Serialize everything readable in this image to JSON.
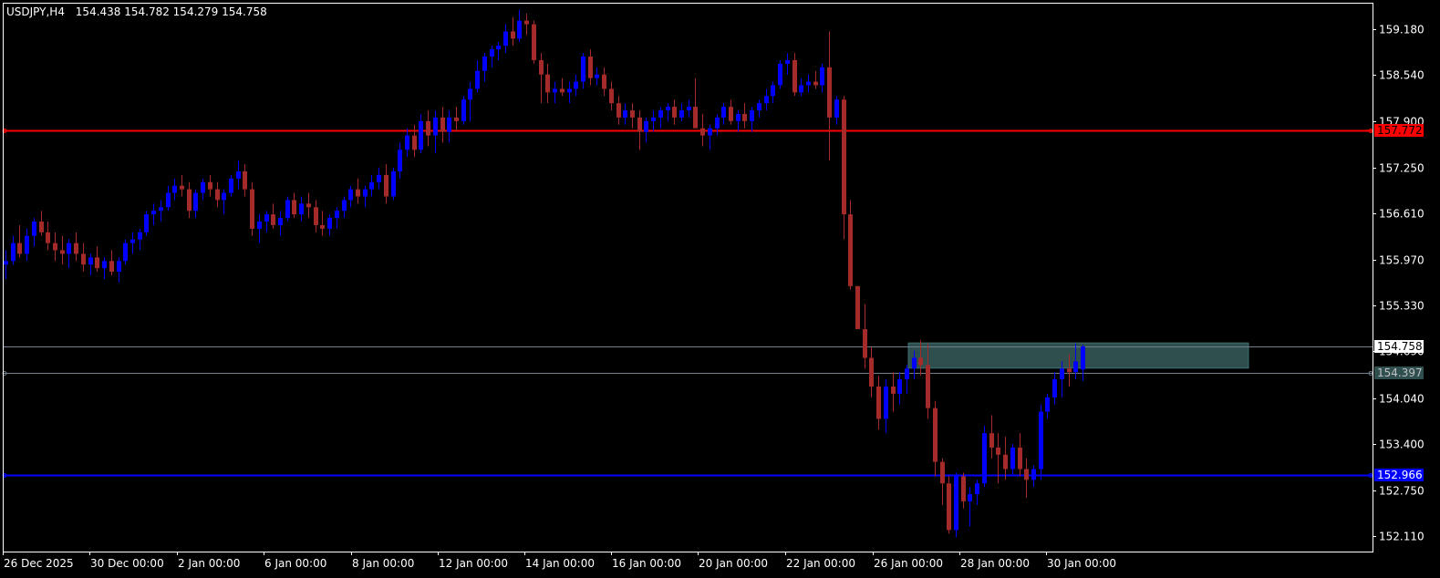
{
  "header": {
    "symbol": "USDJPY,H4",
    "ohlc": "154.438 154.782 154.279 154.758"
  },
  "colors": {
    "background": "#000000",
    "frame": "#ffffff",
    "bull": "#0000ff",
    "bear": "#a52a2a",
    "resistance": "#ff0000",
    "support": "#0000ff",
    "bid_line": "#708090",
    "zone": "#2f4f4f"
  },
  "chart_data": {
    "type": "candlestick",
    "timeframe": "H4",
    "ylim": [
      151.9,
      159.55
    ],
    "y_ticks": [
      "159.180",
      "158.540",
      "157.900",
      "157.250",
      "156.610",
      "155.970",
      "155.330",
      "154.690",
      "154.040",
      "153.400",
      "152.750",
      "152.110"
    ],
    "x_ticks": [
      "26 Dec 2025",
      "30 Dec 00:00",
      "2 Jan 00:00",
      "6 Jan 00:00",
      "8 Jan 00:00",
      "12 Jan 00:00",
      "14 Jan 00:00",
      "16 Jan 00:00",
      "20 Jan 00:00",
      "22 Jan 00:00",
      "26 Jan 00:00",
      "28 Jan 00:00",
      "30 Jan 00:00"
    ],
    "candles": [
      [
        155.9,
        156.1,
        155.7,
        155.95
      ],
      [
        155.95,
        156.3,
        155.9,
        156.2
      ],
      [
        156.2,
        156.45,
        156.0,
        156.05
      ],
      [
        156.05,
        156.4,
        155.95,
        156.3
      ],
      [
        156.3,
        156.55,
        156.15,
        156.5
      ],
      [
        156.5,
        156.65,
        156.3,
        156.35
      ],
      [
        156.35,
        156.5,
        156.1,
        156.2
      ],
      [
        156.2,
        156.35,
        155.95,
        156.1
      ],
      [
        156.1,
        156.3,
        155.9,
        156.05
      ],
      [
        156.05,
        156.25,
        155.85,
        156.2
      ],
      [
        156.2,
        156.35,
        155.95,
        156.05
      ],
      [
        156.05,
        156.2,
        155.8,
        155.9
      ],
      [
        155.9,
        156.05,
        155.75,
        156.0
      ],
      [
        156.0,
        156.15,
        155.8,
        155.85
      ],
      [
        155.85,
        156.0,
        155.7,
        155.95
      ],
      [
        155.95,
        156.1,
        155.75,
        155.8
      ],
      [
        155.8,
        156.0,
        155.65,
        155.95
      ],
      [
        155.95,
        156.25,
        155.9,
        156.2
      ],
      [
        156.2,
        156.35,
        156.05,
        156.25
      ],
      [
        156.25,
        156.4,
        156.1,
        156.35
      ],
      [
        156.35,
        156.65,
        156.3,
        156.6
      ],
      [
        156.6,
        156.75,
        156.45,
        156.65
      ],
      [
        156.65,
        156.8,
        156.5,
        156.7
      ],
      [
        156.7,
        157.0,
        156.65,
        156.9
      ],
      [
        156.9,
        157.1,
        156.8,
        157.0
      ],
      [
        157.0,
        157.15,
        156.85,
        156.95
      ],
      [
        156.95,
        157.05,
        156.55,
        156.65
      ],
      [
        156.65,
        156.95,
        156.55,
        156.9
      ],
      [
        156.9,
        157.1,
        156.8,
        157.05
      ],
      [
        157.05,
        157.15,
        156.85,
        156.95
      ],
      [
        156.95,
        157.05,
        156.7,
        156.8
      ],
      [
        156.8,
        156.95,
        156.6,
        156.9
      ],
      [
        156.9,
        157.15,
        156.85,
        157.1
      ],
      [
        157.1,
        157.35,
        156.95,
        157.2
      ],
      [
        157.2,
        157.3,
        156.85,
        156.95
      ],
      [
        156.95,
        157.05,
        156.3,
        156.4
      ],
      [
        156.4,
        156.6,
        156.2,
        156.5
      ],
      [
        156.5,
        156.65,
        156.35,
        156.6
      ],
      [
        156.6,
        156.75,
        156.4,
        156.45
      ],
      [
        156.45,
        156.65,
        156.3,
        156.55
      ],
      [
        156.55,
        156.85,
        156.5,
        156.8
      ],
      [
        156.8,
        156.9,
        156.55,
        156.6
      ],
      [
        156.6,
        156.85,
        156.5,
        156.75
      ],
      [
        156.75,
        156.9,
        156.55,
        156.7
      ],
      [
        156.7,
        156.8,
        156.35,
        156.45
      ],
      [
        156.45,
        156.65,
        156.3,
        156.4
      ],
      [
        156.4,
        156.6,
        156.3,
        156.55
      ],
      [
        156.55,
        156.7,
        156.4,
        156.65
      ],
      [
        156.65,
        156.85,
        156.55,
        156.8
      ],
      [
        156.8,
        157.0,
        156.7,
        156.95
      ],
      [
        156.95,
        157.1,
        156.75,
        156.85
      ],
      [
        156.85,
        157.0,
        156.7,
        156.95
      ],
      [
        156.95,
        157.15,
        156.85,
        157.05
      ],
      [
        157.05,
        157.25,
        156.95,
        157.15
      ],
      [
        157.15,
        157.3,
        156.75,
        156.85
      ],
      [
        156.85,
        157.25,
        156.8,
        157.2
      ],
      [
        157.2,
        157.6,
        157.1,
        157.5
      ],
      [
        157.5,
        157.8,
        157.4,
        157.7
      ],
      [
        157.7,
        157.85,
        157.4,
        157.5
      ],
      [
        157.5,
        158.0,
        157.45,
        157.9
      ],
      [
        157.9,
        158.05,
        157.55,
        157.7
      ],
      [
        157.7,
        158.05,
        157.45,
        157.95
      ],
      [
        157.95,
        158.1,
        157.6,
        157.75
      ],
      [
        157.75,
        158.05,
        157.6,
        157.95
      ],
      [
        157.95,
        158.1,
        157.75,
        157.9
      ],
      [
        157.9,
        158.25,
        157.85,
        158.2
      ],
      [
        158.2,
        158.45,
        157.9,
        158.35
      ],
      [
        158.35,
        158.75,
        158.3,
        158.6
      ],
      [
        158.6,
        158.85,
        158.45,
        158.8
      ],
      [
        158.8,
        158.95,
        158.65,
        158.9
      ],
      [
        158.9,
        159.0,
        158.75,
        158.95
      ],
      [
        158.95,
        159.25,
        158.85,
        159.15
      ],
      [
        159.15,
        159.35,
        158.95,
        159.05
      ],
      [
        159.05,
        159.45,
        159.0,
        159.3
      ],
      [
        159.3,
        159.4,
        159.1,
        159.25
      ],
      [
        159.25,
        159.3,
        158.7,
        158.75
      ],
      [
        158.75,
        158.85,
        158.15,
        158.55
      ],
      [
        158.55,
        158.7,
        158.15,
        158.3
      ],
      [
        158.3,
        158.45,
        158.15,
        158.35
      ],
      [
        158.35,
        158.5,
        158.25,
        158.3
      ],
      [
        158.3,
        158.45,
        158.15,
        158.35
      ],
      [
        158.35,
        158.55,
        158.25,
        158.45
      ],
      [
        158.45,
        158.85,
        158.35,
        158.8
      ],
      [
        158.8,
        158.9,
        158.4,
        158.5
      ],
      [
        158.5,
        158.65,
        158.4,
        158.55
      ],
      [
        158.55,
        158.65,
        158.25,
        158.35
      ],
      [
        158.35,
        158.45,
        158.05,
        158.15
      ],
      [
        158.15,
        158.25,
        157.85,
        157.95
      ],
      [
        157.95,
        158.15,
        157.85,
        158.05
      ],
      [
        158.05,
        158.15,
        157.8,
        157.95
      ],
      [
        157.95,
        158.05,
        157.5,
        157.75
      ],
      [
        157.75,
        157.95,
        157.6,
        157.9
      ],
      [
        157.9,
        158.05,
        157.75,
        157.95
      ],
      [
        157.95,
        158.1,
        157.8,
        158.05
      ],
      [
        158.05,
        158.15,
        157.9,
        158.1
      ],
      [
        158.1,
        158.2,
        157.85,
        157.95
      ],
      [
        157.95,
        158.15,
        157.9,
        158.05
      ],
      [
        158.05,
        158.2,
        157.95,
        158.1
      ],
      [
        158.1,
        158.5,
        157.95,
        157.8
      ],
      [
        157.8,
        158.0,
        157.55,
        157.7
      ],
      [
        157.7,
        157.85,
        157.5,
        157.8
      ],
      [
        157.8,
        158.0,
        157.7,
        157.95
      ],
      [
        157.95,
        158.15,
        157.85,
        158.1
      ],
      [
        158.1,
        158.2,
        157.85,
        157.9
      ],
      [
        157.9,
        158.05,
        157.75,
        158.0
      ],
      [
        158.0,
        158.15,
        157.8,
        157.9
      ],
      [
        157.9,
        158.1,
        157.75,
        158.05
      ],
      [
        158.05,
        158.2,
        157.95,
        158.15
      ],
      [
        158.15,
        158.35,
        158.05,
        158.25
      ],
      [
        158.25,
        158.45,
        158.15,
        158.4
      ],
      [
        158.4,
        158.75,
        158.35,
        158.7
      ],
      [
        158.7,
        158.85,
        158.55,
        158.75
      ],
      [
        158.75,
        158.85,
        158.25,
        158.3
      ],
      [
        158.3,
        158.5,
        158.25,
        158.4
      ],
      [
        158.4,
        158.55,
        158.3,
        158.45
      ],
      [
        158.45,
        158.6,
        158.35,
        158.4
      ],
      [
        158.4,
        158.7,
        158.3,
        158.65
      ],
      [
        158.65,
        159.15,
        157.35,
        157.95
      ],
      [
        157.95,
        158.25,
        157.85,
        158.2
      ],
      [
        158.2,
        158.25,
        156.25,
        156.6
      ],
      [
        156.6,
        156.8,
        155.55,
        155.6
      ],
      [
        155.6,
        155.6,
        155.0,
        155.0
      ],
      [
        155.0,
        155.35,
        154.45,
        154.6
      ],
      [
        154.6,
        154.75,
        154.05,
        154.2
      ],
      [
        154.2,
        154.35,
        153.6,
        153.75
      ],
      [
        153.75,
        154.3,
        153.55,
        154.2
      ],
      [
        154.2,
        154.4,
        153.85,
        154.1
      ],
      [
        154.1,
        154.4,
        153.95,
        154.3
      ],
      [
        154.3,
        154.5,
        154.1,
        154.45
      ],
      [
        154.45,
        154.7,
        154.3,
        154.6
      ],
      [
        154.6,
        154.85,
        154.35,
        154.5
      ],
      [
        154.5,
        154.8,
        153.75,
        153.9
      ],
      [
        153.9,
        154.0,
        152.95,
        153.15
      ],
      [
        153.15,
        153.2,
        152.55,
        152.85
      ],
      [
        152.85,
        152.95,
        152.15,
        152.2
      ],
      [
        152.2,
        153.0,
        152.1,
        152.95
      ],
      [
        152.95,
        153.0,
        152.5,
        152.6
      ],
      [
        152.6,
        152.8,
        152.25,
        152.7
      ],
      [
        152.7,
        152.9,
        152.55,
        152.85
      ],
      [
        152.85,
        153.65,
        152.8,
        153.55
      ],
      [
        153.55,
        153.8,
        153.2,
        153.35
      ],
      [
        153.35,
        153.55,
        152.85,
        153.25
      ],
      [
        153.25,
        153.5,
        152.9,
        153.05
      ],
      [
        153.05,
        153.4,
        152.95,
        153.35
      ],
      [
        153.35,
        153.55,
        152.95,
        153.05
      ],
      [
        153.05,
        153.2,
        152.65,
        152.9
      ],
      [
        152.9,
        153.1,
        152.8,
        153.05
      ],
      [
        153.05,
        153.95,
        152.9,
        153.85
      ],
      [
        153.85,
        154.1,
        153.75,
        154.05
      ],
      [
        154.05,
        154.4,
        153.95,
        154.3
      ],
      [
        154.3,
        154.55,
        154.05,
        154.45
      ],
      [
        154.45,
        154.65,
        154.2,
        154.4
      ],
      [
        154.4,
        154.8,
        154.3,
        154.55
      ],
      [
        154.438,
        154.782,
        154.279,
        154.758
      ]
    ],
    "levels": {
      "resistance": "157.772",
      "bid": "154.758",
      "zone_lower": "154.397",
      "support": "152.966"
    }
  }
}
